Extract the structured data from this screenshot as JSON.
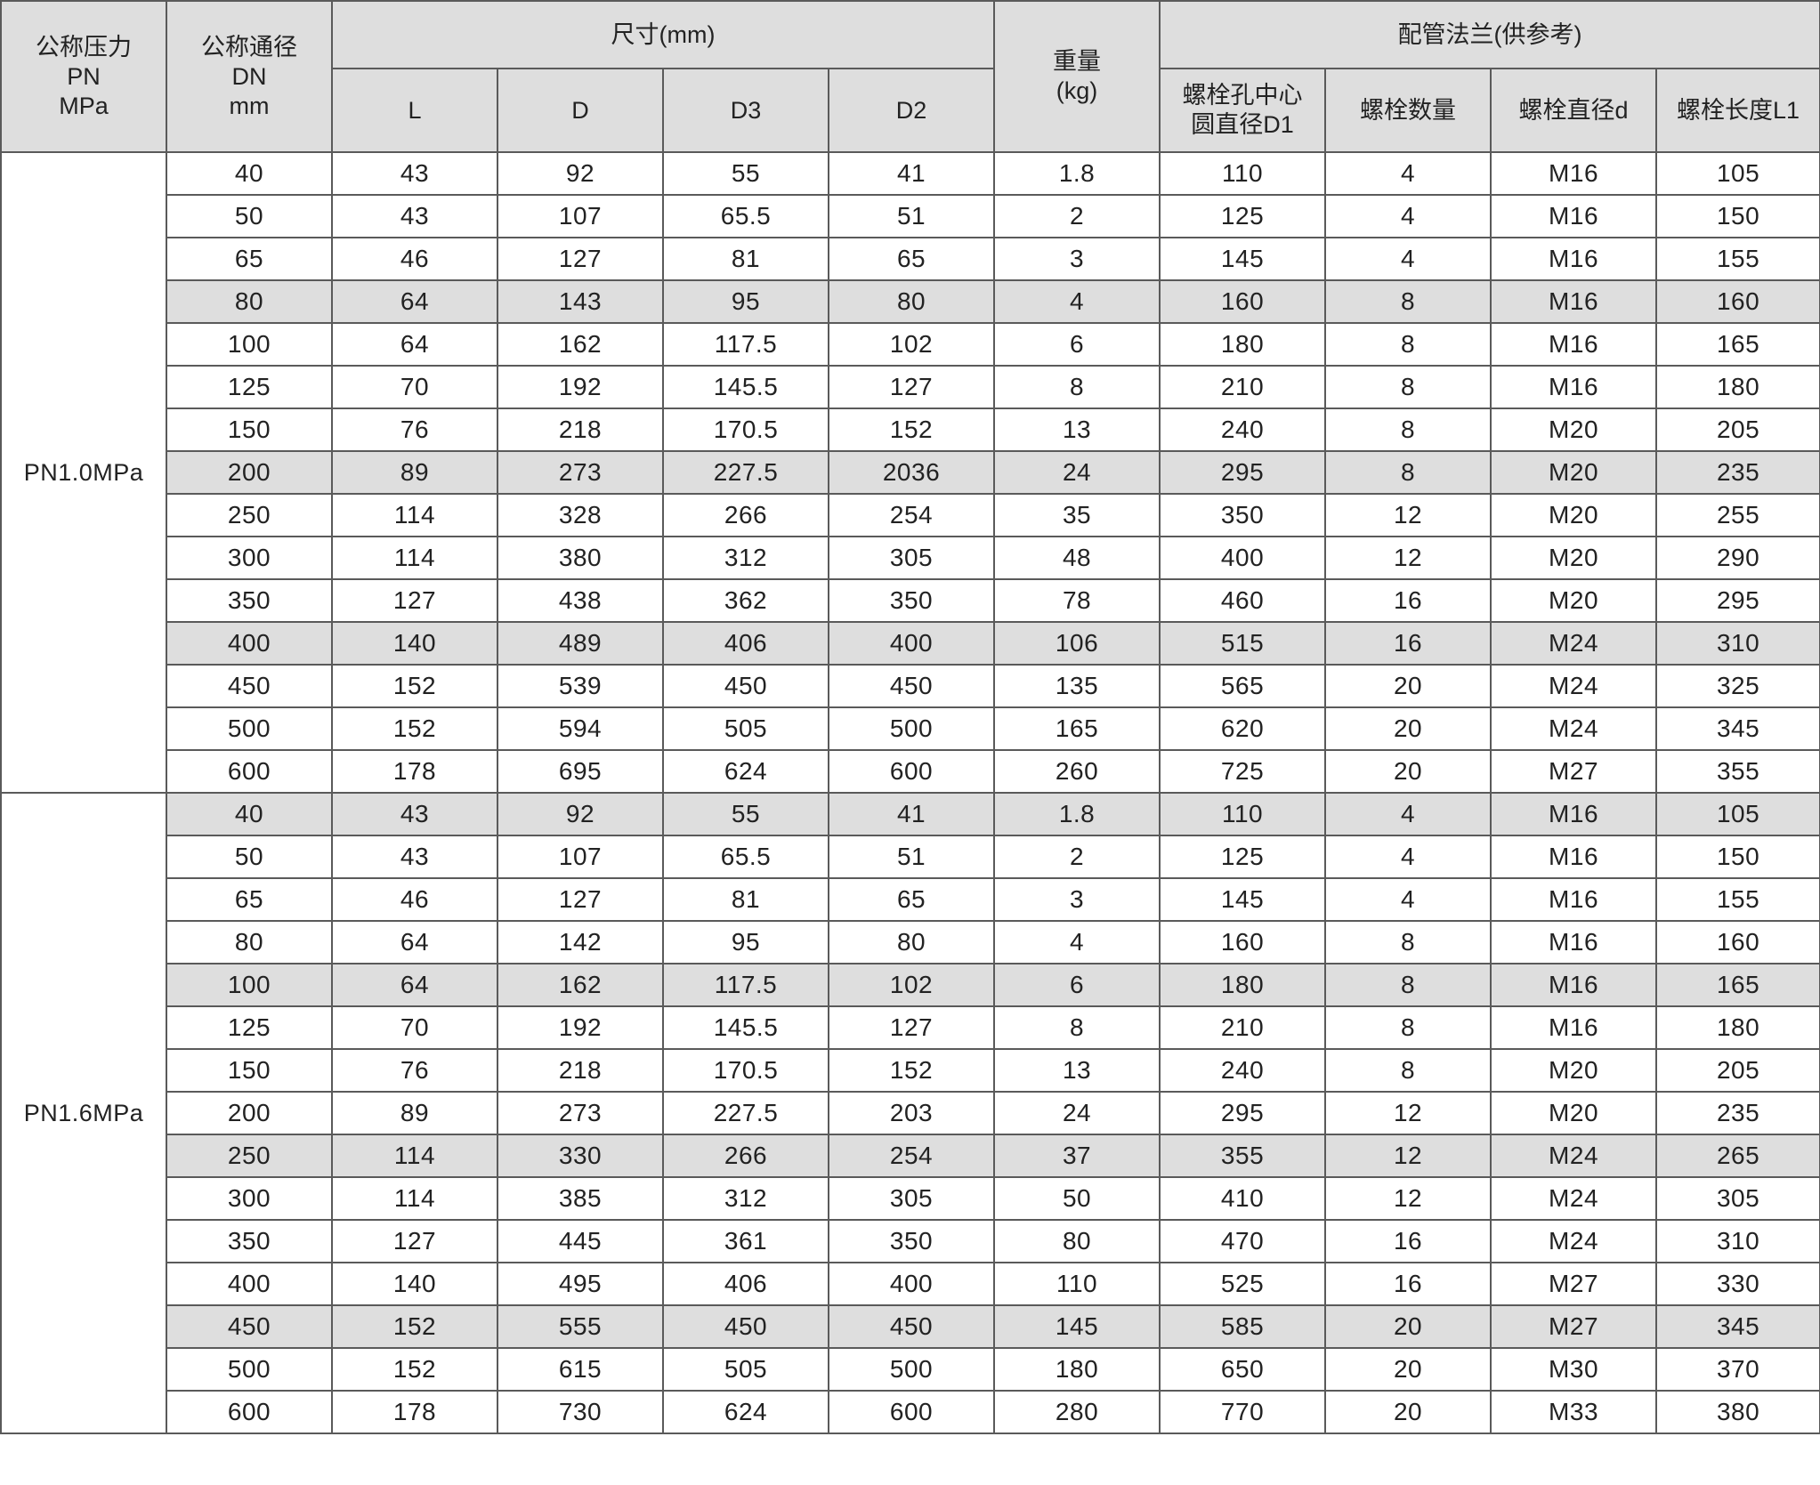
{
  "header": {
    "pn": [
      "公称压力",
      "PN",
      "MPa"
    ],
    "dn": [
      "公称通径",
      "DN",
      "mm"
    ],
    "size_group": "尺寸(mm)",
    "weight": [
      "重量",
      "(kg)"
    ],
    "flange_group": "配管法兰(供参考)",
    "L": "L",
    "D": "D",
    "D3": "D3",
    "D2": "D2",
    "D1": [
      "螺栓孔中心",
      "圆直径D1"
    ],
    "bolt_count": "螺栓数量",
    "bolt_dia": "螺栓直径d",
    "bolt_len": "螺栓长度L1"
  },
  "groups": [
    {
      "label": "PN1.0MPa",
      "rows": [
        [
          "40",
          "43",
          "92",
          "55",
          "41",
          "1.8",
          "110",
          "4",
          "M16",
          "105"
        ],
        [
          "50",
          "43",
          "107",
          "65.5",
          "51",
          "2",
          "125",
          "4",
          "M16",
          "150"
        ],
        [
          "65",
          "46",
          "127",
          "81",
          "65",
          "3",
          "145",
          "4",
          "M16",
          "155"
        ],
        [
          "80",
          "64",
          "143",
          "95",
          "80",
          "4",
          "160",
          "8",
          "M16",
          "160"
        ],
        [
          "100",
          "64",
          "162",
          "117.5",
          "102",
          "6",
          "180",
          "8",
          "M16",
          "165"
        ],
        [
          "125",
          "70",
          "192",
          "145.5",
          "127",
          "8",
          "210",
          "8",
          "M16",
          "180"
        ],
        [
          "150",
          "76",
          "218",
          "170.5",
          "152",
          "13",
          "240",
          "8",
          "M20",
          "205"
        ],
        [
          "200",
          "89",
          "273",
          "227.5",
          "2036",
          "24",
          "295",
          "8",
          "M20",
          "235"
        ],
        [
          "250",
          "114",
          "328",
          "266",
          "254",
          "35",
          "350",
          "12",
          "M20",
          "255"
        ],
        [
          "300",
          "114",
          "380",
          "312",
          "305",
          "48",
          "400",
          "12",
          "M20",
          "290"
        ],
        [
          "350",
          "127",
          "438",
          "362",
          "350",
          "78",
          "460",
          "16",
          "M20",
          "295"
        ],
        [
          "400",
          "140",
          "489",
          "406",
          "400",
          "106",
          "515",
          "16",
          "M24",
          "310"
        ],
        [
          "450",
          "152",
          "539",
          "450",
          "450",
          "135",
          "565",
          "20",
          "M24",
          "325"
        ],
        [
          "500",
          "152",
          "594",
          "505",
          "500",
          "165",
          "620",
          "20",
          "M24",
          "345"
        ],
        [
          "600",
          "178",
          "695",
          "624",
          "600",
          "260",
          "725",
          "20",
          "M27",
          "355"
        ]
      ],
      "shaded": [
        3,
        7,
        11
      ]
    },
    {
      "label": "PN1.6MPa",
      "rows": [
        [
          "40",
          "43",
          "92",
          "55",
          "41",
          "1.8",
          "110",
          "4",
          "M16",
          "105"
        ],
        [
          "50",
          "43",
          "107",
          "65.5",
          "51",
          "2",
          "125",
          "4",
          "M16",
          "150"
        ],
        [
          "65",
          "46",
          "127",
          "81",
          "65",
          "3",
          "145",
          "4",
          "M16",
          "155"
        ],
        [
          "80",
          "64",
          "142",
          "95",
          "80",
          "4",
          "160",
          "8",
          "M16",
          "160"
        ],
        [
          "100",
          "64",
          "162",
          "117.5",
          "102",
          "6",
          "180",
          "8",
          "M16",
          "165"
        ],
        [
          "125",
          "70",
          "192",
          "145.5",
          "127",
          "8",
          "210",
          "8",
          "M16",
          "180"
        ],
        [
          "150",
          "76",
          "218",
          "170.5",
          "152",
          "13",
          "240",
          "8",
          "M20",
          "205"
        ],
        [
          "200",
          "89",
          "273",
          "227.5",
          "203",
          "24",
          "295",
          "12",
          "M20",
          "235"
        ],
        [
          "250",
          "114",
          "330",
          "266",
          "254",
          "37",
          "355",
          "12",
          "M24",
          "265"
        ],
        [
          "300",
          "114",
          "385",
          "312",
          "305",
          "50",
          "410",
          "12",
          "M24",
          "305"
        ],
        [
          "350",
          "127",
          "445",
          "361",
          "350",
          "80",
          "470",
          "16",
          "M24",
          "310"
        ],
        [
          "400",
          "140",
          "495",
          "406",
          "400",
          "110",
          "525",
          "16",
          "M27",
          "330"
        ],
        [
          "450",
          "152",
          "555",
          "450",
          "450",
          "145",
          "585",
          "20",
          "M27",
          "345"
        ],
        [
          "500",
          "152",
          "615",
          "505",
          "500",
          "180",
          "650",
          "20",
          "M30",
          "370"
        ],
        [
          "600",
          "178",
          "730",
          "624",
          "600",
          "280",
          "770",
          "20",
          "M33",
          "380"
        ]
      ],
      "shaded": [
        0,
        4,
        8,
        12
      ]
    }
  ]
}
